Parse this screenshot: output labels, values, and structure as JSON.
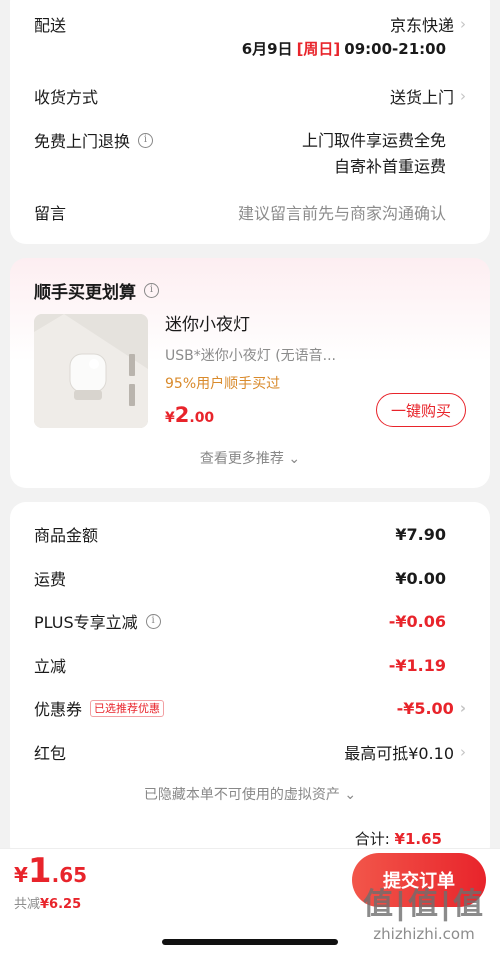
{
  "delivery": {
    "label": "配送",
    "carrier": "京东快递",
    "date": "6月9日",
    "weekday": "[周日]",
    "time": "09:00-21:00",
    "method_label": "收货方式",
    "method_value": "送货上门",
    "return_label": "免费上门退换",
    "return_line1": "上门取件享运费全免",
    "return_line2": "自寄补首重运费",
    "note_label": "留言",
    "note_placeholder": "建议留言前先与商家沟通确认"
  },
  "addon": {
    "title": "顺手买更划算",
    "product_name": "迷你小夜灯",
    "product_desc": "USB*迷你小夜灯 (无语音...",
    "social_proof": "95%用户顺手买过",
    "price_symbol": "¥",
    "price_int": "2",
    "price_dec": ".00",
    "buy_label": "一键购买",
    "more_label": "查看更多推荐"
  },
  "summary": {
    "rows": [
      {
        "label": "商品金额",
        "value": "¥7.90"
      },
      {
        "label": "运费",
        "value": "¥0.00"
      },
      {
        "label": "PLUS专享立减",
        "value": "-¥0.06"
      },
      {
        "label": "立减",
        "value": "-¥1.19"
      },
      {
        "label": "优惠券",
        "tag": "已选推荐优惠",
        "value": "-¥5.00"
      },
      {
        "label": "红包",
        "value": "最高可抵¥0.10"
      }
    ],
    "hidden_assets": "已隐藏本单不可使用的虚拟资产",
    "total_label": "合计:",
    "total_value": "¥1.65"
  },
  "bottom": {
    "price_symbol": "¥",
    "price_int": "1",
    "price_dec": ".65",
    "saved_label": "共减",
    "saved_value": "¥6.25",
    "submit_label": "提交订单"
  },
  "watermark": {
    "text": "值|值|值",
    "url": "zhizhizhi.com"
  },
  "colors": {
    "accent": "#e8242b",
    "page_bg": "#f2f2f2"
  }
}
